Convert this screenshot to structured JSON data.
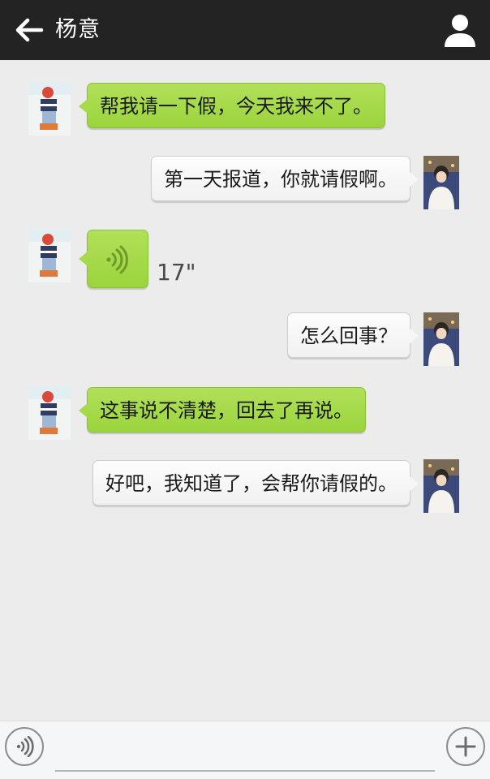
{
  "header": {
    "title": "杨意",
    "back_icon": "arrow-left-icon",
    "profile_icon": "person-icon",
    "background_color": "#232323"
  },
  "messages": [
    {
      "sender": "contact",
      "type": "text",
      "text": "帮我请一下假，今天我来不了。"
    },
    {
      "sender": "me",
      "type": "text",
      "text": "第一天报道，你就请假啊。"
    },
    {
      "sender": "contact",
      "type": "voice",
      "duration": "17\""
    },
    {
      "sender": "me",
      "type": "text",
      "text": "怎么回事？"
    },
    {
      "sender": "contact",
      "type": "text",
      "text": "这事说不清楚，回去了再说。"
    },
    {
      "sender": "me",
      "type": "text",
      "text": "好吧，我知道了，会帮你请假的。"
    }
  ],
  "input_bar": {
    "value": "",
    "voice_icon": "voice-input-icon",
    "plus_icon": "plus-icon"
  },
  "colors": {
    "contact_bubble": "#a6da4a",
    "my_bubble": "#f6f6f6",
    "chat_background": "#ececec"
  }
}
